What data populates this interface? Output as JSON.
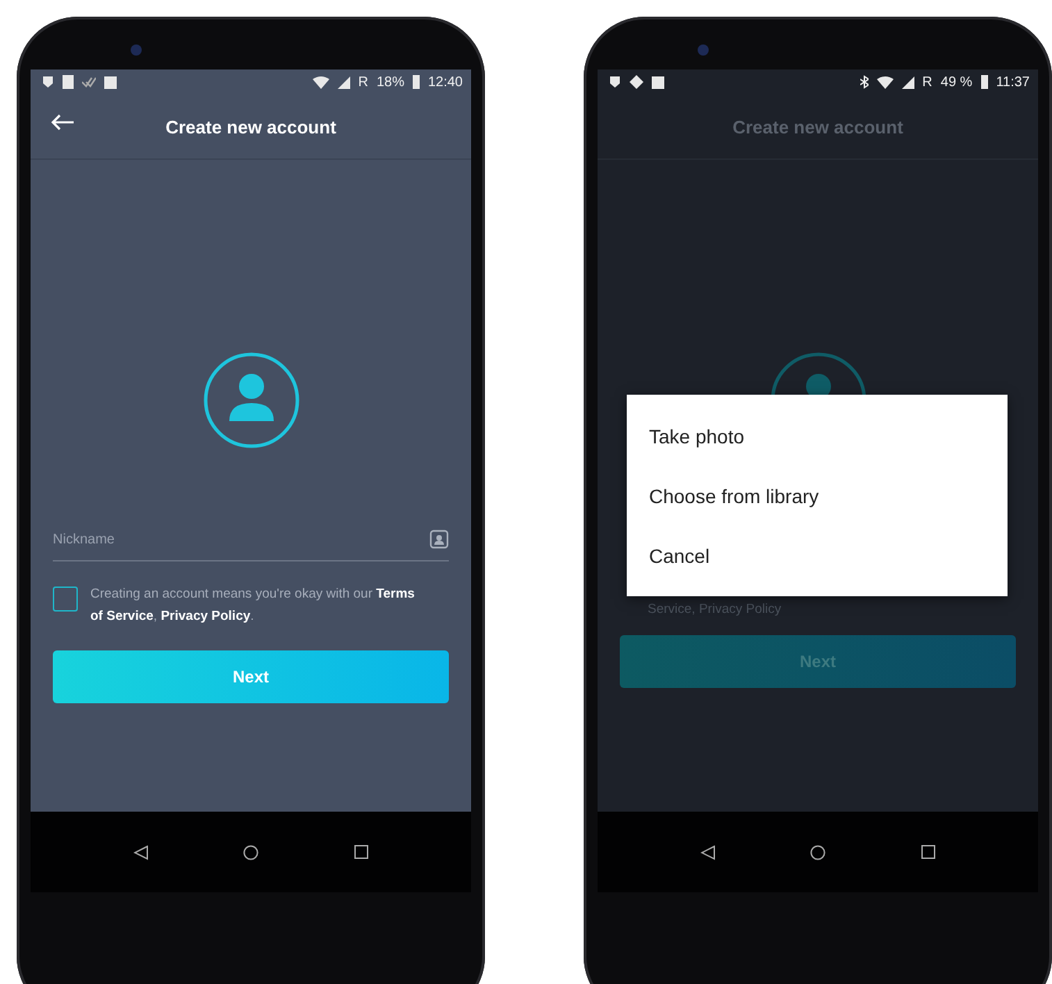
{
  "phones": [
    {
      "dimmed": false,
      "status_bar": {
        "network_mark": "R",
        "battery": "18%",
        "time": "12:40"
      },
      "app_bar": {
        "title": "Create new account",
        "back": true
      },
      "nickname": {
        "placeholder": "Nickname"
      },
      "consent": {
        "checked": false,
        "text": "Creating an account means you're okay with our **Terms of Service**, **Privacy Policy**."
      },
      "next_button": "Next"
    },
    {
      "dimmed": true,
      "status_bar": {
        "bluetooth": true,
        "network_mark": "R",
        "battery": "49 %",
        "time": "11:37"
      },
      "app_bar": {
        "title": "Create new account"
      },
      "consent": {
        "text": "Service, Privacy Policy"
      },
      "next_button": "Next",
      "dialog": {
        "options": [
          "Take photo",
          "Choose from library",
          "Cancel"
        ]
      }
    }
  ]
}
